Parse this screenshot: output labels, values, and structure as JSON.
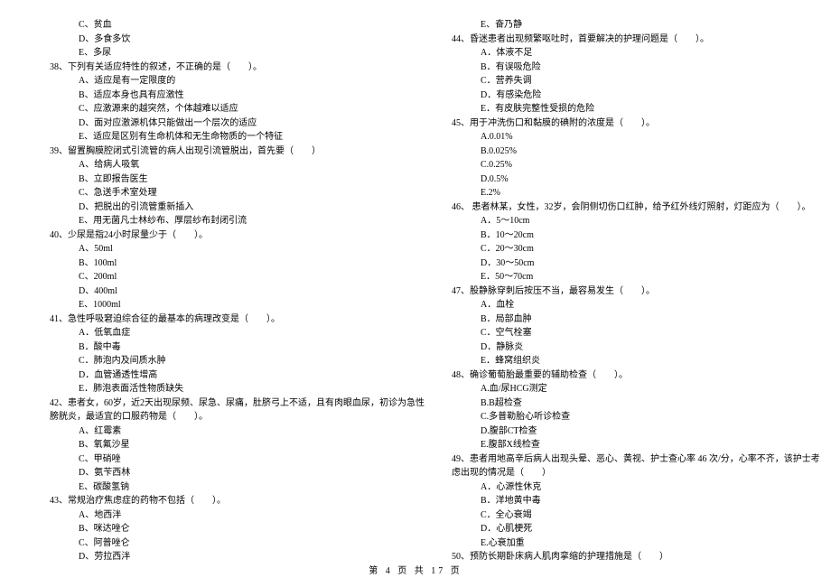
{
  "footer": "第 4 页 共 17 页",
  "left": [
    {
      "cls": "opt",
      "t": "C、贫血"
    },
    {
      "cls": "opt",
      "t": "D、多食多饮"
    },
    {
      "cls": "opt",
      "t": "E、多尿"
    },
    {
      "cls": "q",
      "t": "38、下列有关适应特性的叙述，不正确的是（　　）。"
    },
    {
      "cls": "opt",
      "t": "A、适应是有一定限度的"
    },
    {
      "cls": "opt",
      "t": "B、适应本身也具有应激性"
    },
    {
      "cls": "opt",
      "t": "C、应激源来的越突然，个体越难以适应"
    },
    {
      "cls": "opt",
      "t": "D、面对应激源机体只能做出一个层次的适应"
    },
    {
      "cls": "opt",
      "t": "E、适应是区别有生命机体和无生命物质的一个特征"
    },
    {
      "cls": "q",
      "t": "39、留置胸膜腔闭式引流管的病人出现引流管脱出，首先要（　　）"
    },
    {
      "cls": "opt",
      "t": "A、给病人吸氧"
    },
    {
      "cls": "opt",
      "t": "B、立即报告医生"
    },
    {
      "cls": "opt",
      "t": "C、急送手术室处理"
    },
    {
      "cls": "opt",
      "t": "D、把脱出的引流管重新插入"
    },
    {
      "cls": "opt",
      "t": "E、用无菌凡士林纱布、厚层纱布封闭引流"
    },
    {
      "cls": "q",
      "t": "40、少尿是指24小时尿量少于（　　）。"
    },
    {
      "cls": "opt",
      "t": "A、50ml"
    },
    {
      "cls": "opt",
      "t": "B、100ml"
    },
    {
      "cls": "opt",
      "t": "C、200ml"
    },
    {
      "cls": "opt",
      "t": "D、400ml"
    },
    {
      "cls": "opt",
      "t": "E、1000ml"
    },
    {
      "cls": "q",
      "t": "41、急性呼吸窘迫综合征的最基本的病理改变是（　　）。"
    },
    {
      "cls": "opt",
      "t": "A．低氧血症"
    },
    {
      "cls": "opt",
      "t": "B．酸中毒"
    },
    {
      "cls": "opt",
      "t": "C．肺泡内及间质水肿"
    },
    {
      "cls": "opt",
      "t": "D．血管通透性增高"
    },
    {
      "cls": "opt",
      "t": "E．肺泡表面活性物质缺失"
    },
    {
      "cls": "q",
      "t": "42、患者女，60岁，近2天出现尿频、尿急、尿痛，肚脐弓上不适，且有肉眼血尿，初诊为急性"
    },
    {
      "cls": "q",
      "t": "膀胱炎，最适宜的口服药物是（　　）。"
    },
    {
      "cls": "opt",
      "t": "A、红霉素"
    },
    {
      "cls": "opt",
      "t": "B、氧氟沙星"
    },
    {
      "cls": "opt",
      "t": "C、甲硝唑"
    },
    {
      "cls": "opt",
      "t": "D、氨苄西林"
    },
    {
      "cls": "opt",
      "t": "E、碳酸氢钠"
    },
    {
      "cls": "q",
      "t": "43、常规治疗焦虑症的药物不包括（　　）。"
    },
    {
      "cls": "opt",
      "t": "A、地西泮"
    },
    {
      "cls": "opt",
      "t": "B、咪达唑仑"
    },
    {
      "cls": "opt",
      "t": "C、阿普唑仑"
    },
    {
      "cls": "opt",
      "t": "D、劳拉西泮"
    }
  ],
  "right": [
    {
      "cls": "opt",
      "t": "E、奋乃静"
    },
    {
      "cls": "q",
      "t": "44、昏迷患者出现频繁呕吐时，首要解决的护理问题是（　　）。"
    },
    {
      "cls": "opt",
      "t": "A．体液不足"
    },
    {
      "cls": "opt",
      "t": "B．有误吸危险"
    },
    {
      "cls": "opt",
      "t": "C．营养失调"
    },
    {
      "cls": "opt",
      "t": "D．有感染危险"
    },
    {
      "cls": "opt",
      "t": "E．有皮肤完整性受损的危险"
    },
    {
      "cls": "q",
      "t": "45、用于冲洗伤口和黏膜的碘附的浓度是（　　）。"
    },
    {
      "cls": "opt",
      "t": "A.0.01%"
    },
    {
      "cls": "opt",
      "t": "B.0.025%"
    },
    {
      "cls": "opt",
      "t": "C.0.25%"
    },
    {
      "cls": "opt",
      "t": "D.0.5%"
    },
    {
      "cls": "opt",
      "t": "E.2%"
    },
    {
      "cls": "q",
      "t": "46、 患者林某，女性，32岁，会阴侧切伤口红肿，给予红外线灯照射，灯距应为（　　）。"
    },
    {
      "cls": "opt",
      "t": "A．5～10cm"
    },
    {
      "cls": "opt",
      "t": "B．10～20cm"
    },
    {
      "cls": "opt",
      "t": "C．20～30cm"
    },
    {
      "cls": "opt",
      "t": "D．30～50cm"
    },
    {
      "cls": "opt",
      "t": "E．50～70cm"
    },
    {
      "cls": "q",
      "t": "47、股静脉穿刺后按压不当，最容易发生（　　）。"
    },
    {
      "cls": "opt",
      "t": "A．血栓"
    },
    {
      "cls": "opt",
      "t": "B．局部血肿"
    },
    {
      "cls": "opt",
      "t": "C．空气栓塞"
    },
    {
      "cls": "opt",
      "t": "D．静脉炎"
    },
    {
      "cls": "opt",
      "t": "E．蜂窝组织炎"
    },
    {
      "cls": "q",
      "t": "48、确诊葡萄胎最重要的辅助检查（　　）。"
    },
    {
      "cls": "opt",
      "t": "A.血/尿HCG测定"
    },
    {
      "cls": "opt",
      "t": "B.B超检查"
    },
    {
      "cls": "opt",
      "t": "C.多普勒胎心听诊检查"
    },
    {
      "cls": "opt",
      "t": "D.腹部CT检查"
    },
    {
      "cls": "opt",
      "t": "E.腹部X线检查"
    },
    {
      "cls": "q",
      "t": "49、患者用地高辛后病人出现头晕、恶心、黄视、护士查心率 46 次/分，心率不齐，该护士考"
    },
    {
      "cls": "q",
      "t": "虑出现的情况是（　　）"
    },
    {
      "cls": "opt",
      "t": "A．心源性休克"
    },
    {
      "cls": "opt",
      "t": "B．洋地黄中毒"
    },
    {
      "cls": "opt",
      "t": "C．全心衰竭"
    },
    {
      "cls": "opt",
      "t": "D．心肌梗死"
    },
    {
      "cls": "opt",
      "t": "E.心衰加重"
    },
    {
      "cls": "q",
      "t": "50、预防长期卧床病人肌肉挛缩的护理措施是（　　）"
    }
  ]
}
